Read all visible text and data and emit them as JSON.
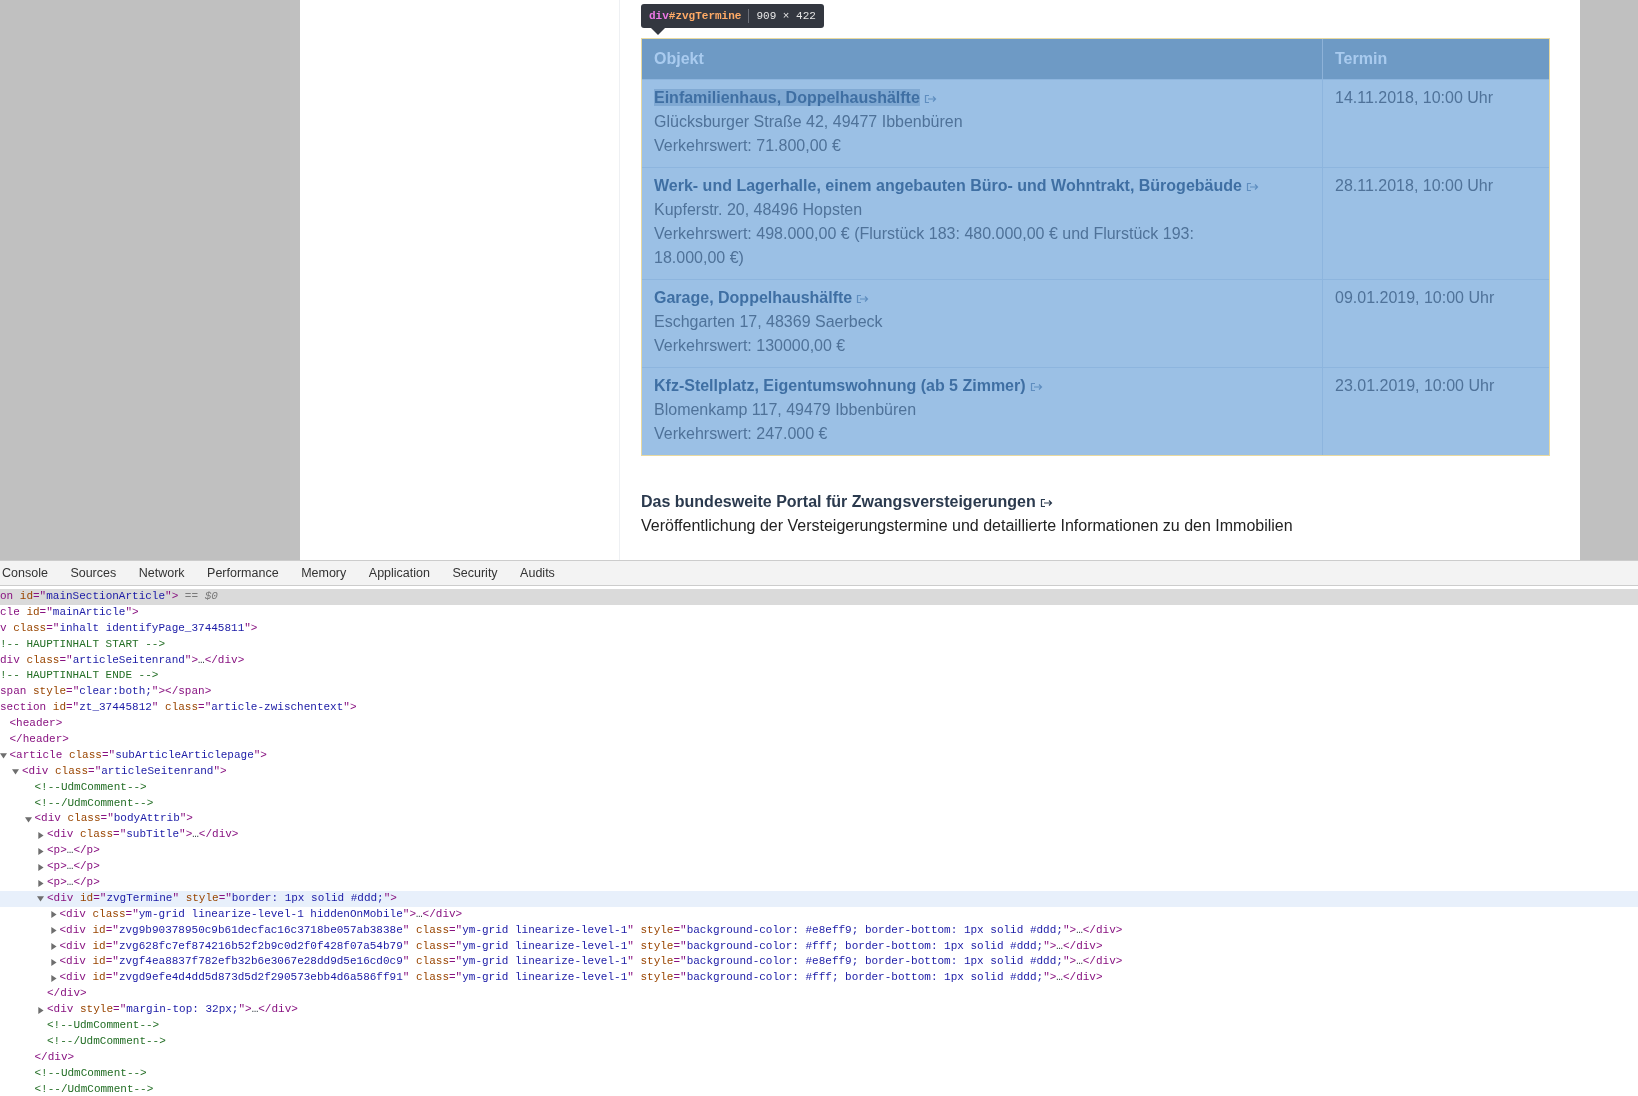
{
  "tooltip": {
    "tag": "div",
    "id": "#zvgTermine",
    "size": "909 × 422"
  },
  "table": {
    "columns": [
      "Objekt",
      "Termin"
    ],
    "rows": [
      {
        "title": "Einfamilienhaus, Doppelhaushälfte",
        "highlighted": true,
        "lines": [
          "Glücksburger Straße 42, 49477 Ibbenbüren",
          "Verkehrswert: 71.800,00 €"
        ],
        "date": "14.11.2018, 10:00 Uhr"
      },
      {
        "title": "Werk- und Lagerhalle, einem angebauten Büro- und Wohntrakt, Bürogebäude",
        "highlighted": false,
        "lines": [
          "Kupferstr. 20, 48496 Hopsten",
          "Verkehrswert: 498.000,00 € (Flurstück 183: 480.000,00 € und Flurstück 193: 18.000,00 €)"
        ],
        "date": "28.11.2018, 10:00 Uhr"
      },
      {
        "title": "Garage, Doppelhaushälfte",
        "highlighted": false,
        "lines": [
          "Eschgarten 17, 48369 Saerbeck",
          "Verkehrswert: 130000,00 €"
        ],
        "date": "09.01.2019, 10:00 Uhr"
      },
      {
        "title": "Kfz-Stellplatz, Eigentumswohnung (ab 5 Zimmer)",
        "highlighted": false,
        "lines": [
          "Blomenkamp 117, 49479 Ibbenbüren",
          "Verkehrswert: 247.000 €"
        ],
        "date": "23.01.2019, 10:00 Uhr"
      }
    ]
  },
  "portal": {
    "link": "Das bundesweite Portal für Zwangsversteigerungen",
    "description": "Veröffentlichung der Versteigerungstermine und detaillierte Informationen zu den Immobilien"
  },
  "devtools": {
    "tabs": [
      "Console",
      "Sources",
      "Network",
      "Performance",
      "Memory",
      "Application",
      "Security",
      "Audits"
    ],
    "nodes": [
      {
        "selected": true,
        "hovered": false,
        "tokens": [
          {
            "kind": "tag",
            "text": "on "
          },
          {
            "kind": "attr",
            "text": "id"
          },
          {
            "kind": "tag",
            "text": "=\""
          },
          {
            "kind": "value",
            "text": "mainSectionArticle"
          },
          {
            "kind": "tag",
            "text": "\">"
          },
          {
            "kind": "hint",
            "text": " == $0"
          }
        ]
      },
      {
        "selected": false,
        "hovered": false,
        "tokens": [
          {
            "kind": "tag",
            "text": "cle "
          },
          {
            "kind": "attr",
            "text": "id"
          },
          {
            "kind": "tag",
            "text": "=\""
          },
          {
            "kind": "value",
            "text": "mainArticle"
          },
          {
            "kind": "tag",
            "text": "\">"
          }
        ]
      },
      {
        "selected": false,
        "hovered": false,
        "tokens": [
          {
            "kind": "tag",
            "text": "v "
          },
          {
            "kind": "attr",
            "text": "class"
          },
          {
            "kind": "tag",
            "text": "=\""
          },
          {
            "kind": "value",
            "text": "inhalt identifyPage_37445811"
          },
          {
            "kind": "tag",
            "text": "\">"
          }
        ]
      },
      {
        "selected": false,
        "hovered": false,
        "tokens": [
          {
            "kind": "comment",
            "text": "!-- HAUPTINHALT START -->"
          }
        ]
      },
      {
        "selected": false,
        "hovered": false,
        "tokens": [
          {
            "kind": "tag",
            "text": "div "
          },
          {
            "kind": "attr",
            "text": "class"
          },
          {
            "kind": "tag",
            "text": "=\""
          },
          {
            "kind": "value",
            "text": "articleSeitenrand"
          },
          {
            "kind": "tag",
            "text": "\">"
          },
          {
            "kind": "plain",
            "text": "…"
          },
          {
            "kind": "tag",
            "text": "</div>"
          }
        ]
      },
      {
        "selected": false,
        "hovered": false,
        "tokens": [
          {
            "kind": "comment",
            "text": "!-- HAUPTINHALT ENDE -->"
          }
        ]
      },
      {
        "selected": false,
        "hovered": false,
        "tokens": [
          {
            "kind": "tag",
            "text": "span "
          },
          {
            "kind": "attr",
            "text": "style"
          },
          {
            "kind": "tag",
            "text": "=\""
          },
          {
            "kind": "value",
            "text": "clear:both;"
          },
          {
            "kind": "tag",
            "text": "\"></span>"
          }
        ]
      },
      {
        "selected": false,
        "hovered": false,
        "tokens": [
          {
            "kind": "tag",
            "text": "section "
          },
          {
            "kind": "attr",
            "text": "id"
          },
          {
            "kind": "tag",
            "text": "=\""
          },
          {
            "kind": "value",
            "text": "zt_37445812"
          },
          {
            "kind": "tag",
            "text": "\" "
          },
          {
            "kind": "attr",
            "text": "class"
          },
          {
            "kind": "tag",
            "text": "=\""
          },
          {
            "kind": "value",
            "text": "article-zwischentext"
          },
          {
            "kind": "tag",
            "text": "\">"
          }
        ],
        "children": [
          {
            "selected": false,
            "hovered": false,
            "tokens": [
              {
                "kind": "tag",
                "text": "<header>"
              }
            ]
          },
          {
            "selected": false,
            "hovered": false,
            "tokens": [
              {
                "kind": "tag",
                "text": "</header>"
              }
            ]
          },
          {
            "selected": false,
            "hovered": false,
            "expanded": true,
            "tokens": [
              {
                "kind": "tag",
                "text": "<article "
              },
              {
                "kind": "attr",
                "text": "class"
              },
              {
                "kind": "tag",
                "text": "=\""
              },
              {
                "kind": "value",
                "text": "subArticleArticlepage"
              },
              {
                "kind": "tag",
                "text": "\">"
              }
            ],
            "children": [
              {
                "selected": false,
                "hovered": false,
                "expanded": true,
                "tokens": [
                  {
                    "kind": "tag",
                    "text": "<div "
                  },
                  {
                    "kind": "attr",
                    "text": "class"
                  },
                  {
                    "kind": "tag",
                    "text": "=\""
                  },
                  {
                    "kind": "value",
                    "text": "articleSeitenrand"
                  },
                  {
                    "kind": "tag",
                    "text": "\">"
                  }
                ],
                "children": [
                  {
                    "selected": false,
                    "hovered": false,
                    "tokens": [
                      {
                        "kind": "comment",
                        "text": "<!--UdmComment-->"
                      }
                    ]
                  },
                  {
                    "selected": false,
                    "hovered": false,
                    "tokens": [
                      {
                        "kind": "comment",
                        "text": "<!--/UdmComment-->"
                      }
                    ]
                  },
                  {
                    "selected": false,
                    "hovered": false,
                    "expanded": true,
                    "tokens": [
                      {
                        "kind": "tag",
                        "text": "<div "
                      },
                      {
                        "kind": "attr",
                        "text": "class"
                      },
                      {
                        "kind": "tag",
                        "text": "=\""
                      },
                      {
                        "kind": "value",
                        "text": "bodyAttrib"
                      },
                      {
                        "kind": "tag",
                        "text": "\">"
                      }
                    ],
                    "closing": [
                      {
                        "kind": "tag",
                        "text": "</div>"
                      }
                    ],
                    "children": [
                      {
                        "selected": false,
                        "hovered": false,
                        "expanded": false,
                        "tokens": [
                          {
                            "kind": "tag",
                            "text": "<div "
                          },
                          {
                            "kind": "attr",
                            "text": "class"
                          },
                          {
                            "kind": "tag",
                            "text": "=\""
                          },
                          {
                            "kind": "value",
                            "text": "subTitle"
                          },
                          {
                            "kind": "tag",
                            "text": "\">"
                          },
                          {
                            "kind": "plain",
                            "text": "…"
                          },
                          {
                            "kind": "tag",
                            "text": "</div>"
                          }
                        ]
                      },
                      {
                        "selected": false,
                        "hovered": false,
                        "expanded": false,
                        "tokens": [
                          {
                            "kind": "tag",
                            "text": "<p>"
                          },
                          {
                            "kind": "plain",
                            "text": "…"
                          },
                          {
                            "kind": "tag",
                            "text": "</p>"
                          }
                        ]
                      },
                      {
                        "selected": false,
                        "hovered": false,
                        "expanded": false,
                        "tokens": [
                          {
                            "kind": "tag",
                            "text": "<p>"
                          },
                          {
                            "kind": "plain",
                            "text": "…"
                          },
                          {
                            "kind": "tag",
                            "text": "</p>"
                          }
                        ]
                      },
                      {
                        "selected": false,
                        "hovered": false,
                        "expanded": false,
                        "tokens": [
                          {
                            "kind": "tag",
                            "text": "<p>"
                          },
                          {
                            "kind": "plain",
                            "text": "…"
                          },
                          {
                            "kind": "tag",
                            "text": "</p>"
                          }
                        ]
                      },
                      {
                        "selected": false,
                        "hovered": true,
                        "expanded": true,
                        "tokens": [
                          {
                            "kind": "tag",
                            "text": "<div "
                          },
                          {
                            "kind": "attr",
                            "text": "id"
                          },
                          {
                            "kind": "tag",
                            "text": "=\""
                          },
                          {
                            "kind": "value",
                            "text": "zvgTermine"
                          },
                          {
                            "kind": "tag",
                            "text": "\" "
                          },
                          {
                            "kind": "attr",
                            "text": "style"
                          },
                          {
                            "kind": "tag",
                            "text": "=\""
                          },
                          {
                            "kind": "value",
                            "text": "border: 1px solid #ddd;"
                          },
                          {
                            "kind": "tag",
                            "text": "\">"
                          }
                        ],
                        "closing": [
                          {
                            "kind": "tag",
                            "text": "</div>"
                          }
                        ],
                        "children": [
                          {
                            "selected": false,
                            "hovered": false,
                            "expanded": false,
                            "tokens": [
                              {
                                "kind": "tag",
                                "text": "<div "
                              },
                              {
                                "kind": "attr",
                                "text": "class"
                              },
                              {
                                "kind": "tag",
                                "text": "=\""
                              },
                              {
                                "kind": "value",
                                "text": "ym-grid linearize-level-1 hiddenOnMobile"
                              },
                              {
                                "kind": "tag",
                                "text": "\">"
                              },
                              {
                                "kind": "plain",
                                "text": "…"
                              },
                              {
                                "kind": "tag",
                                "text": "</div>"
                              }
                            ]
                          },
                          {
                            "selected": false,
                            "hovered": false,
                            "expanded": false,
                            "tokens": [
                              {
                                "kind": "tag",
                                "text": "<div "
                              },
                              {
                                "kind": "attr",
                                "text": "id"
                              },
                              {
                                "kind": "tag",
                                "text": "=\""
                              },
                              {
                                "kind": "value",
                                "text": "zvg9b90378950c9b61decfac16c3718be057ab3838e"
                              },
                              {
                                "kind": "tag",
                                "text": "\" "
                              },
                              {
                                "kind": "attr",
                                "text": "class"
                              },
                              {
                                "kind": "tag",
                                "text": "=\""
                              },
                              {
                                "kind": "value",
                                "text": "ym-grid linearize-level-1"
                              },
                              {
                                "kind": "tag",
                                "text": "\" "
                              },
                              {
                                "kind": "attr",
                                "text": "style"
                              },
                              {
                                "kind": "tag",
                                "text": "=\""
                              },
                              {
                                "kind": "value",
                                "text": "background-color: #e8eff9; border-bottom: 1px solid #ddd;"
                              },
                              {
                                "kind": "tag",
                                "text": "\">"
                              },
                              {
                                "kind": "plain",
                                "text": "…"
                              },
                              {
                                "kind": "tag",
                                "text": "</div>"
                              }
                            ]
                          },
                          {
                            "selected": false,
                            "hovered": false,
                            "expanded": false,
                            "tokens": [
                              {
                                "kind": "tag",
                                "text": "<div "
                              },
                              {
                                "kind": "attr",
                                "text": "id"
                              },
                              {
                                "kind": "tag",
                                "text": "=\""
                              },
                              {
                                "kind": "value",
                                "text": "zvg628fc7ef874216b52f2b9c0d2f0f428f07a54b79"
                              },
                              {
                                "kind": "tag",
                                "text": "\" "
                              },
                              {
                                "kind": "attr",
                                "text": "class"
                              },
                              {
                                "kind": "tag",
                                "text": "=\""
                              },
                              {
                                "kind": "value",
                                "text": "ym-grid linearize-level-1"
                              },
                              {
                                "kind": "tag",
                                "text": "\" "
                              },
                              {
                                "kind": "attr",
                                "text": "style"
                              },
                              {
                                "kind": "tag",
                                "text": "=\""
                              },
                              {
                                "kind": "value",
                                "text": "background-color: #fff; border-bottom: 1px solid #ddd;"
                              },
                              {
                                "kind": "tag",
                                "text": "\">"
                              },
                              {
                                "kind": "plain",
                                "text": "…"
                              },
                              {
                                "kind": "tag",
                                "text": "</div>"
                              }
                            ]
                          },
                          {
                            "selected": false,
                            "hovered": false,
                            "expanded": false,
                            "tokens": [
                              {
                                "kind": "tag",
                                "text": "<div "
                              },
                              {
                                "kind": "attr",
                                "text": "id"
                              },
                              {
                                "kind": "tag",
                                "text": "=\""
                              },
                              {
                                "kind": "value",
                                "text": "zvgf4ea8837f782efb32b6e3067e28dd9d5e16cd0c9"
                              },
                              {
                                "kind": "tag",
                                "text": "\" "
                              },
                              {
                                "kind": "attr",
                                "text": "class"
                              },
                              {
                                "kind": "tag",
                                "text": "=\""
                              },
                              {
                                "kind": "value",
                                "text": "ym-grid linearize-level-1"
                              },
                              {
                                "kind": "tag",
                                "text": "\" "
                              },
                              {
                                "kind": "attr",
                                "text": "style"
                              },
                              {
                                "kind": "tag",
                                "text": "=\""
                              },
                              {
                                "kind": "value",
                                "text": "background-color: #e8eff9; border-bottom: 1px solid #ddd;"
                              },
                              {
                                "kind": "tag",
                                "text": "\">"
                              },
                              {
                                "kind": "plain",
                                "text": "…"
                              },
                              {
                                "kind": "tag",
                                "text": "</div>"
                              }
                            ]
                          },
                          {
                            "selected": false,
                            "hovered": false,
                            "expanded": false,
                            "tokens": [
                              {
                                "kind": "tag",
                                "text": "<div "
                              },
                              {
                                "kind": "attr",
                                "text": "id"
                              },
                              {
                                "kind": "tag",
                                "text": "=\""
                              },
                              {
                                "kind": "value",
                                "text": "zvgd9efe4d4dd5d873d5d2f290573ebb4d6a586ff91"
                              },
                              {
                                "kind": "tag",
                                "text": "\" "
                              },
                              {
                                "kind": "attr",
                                "text": "class"
                              },
                              {
                                "kind": "tag",
                                "text": "=\""
                              },
                              {
                                "kind": "value",
                                "text": "ym-grid linearize-level-1"
                              },
                              {
                                "kind": "tag",
                                "text": "\" "
                              },
                              {
                                "kind": "attr",
                                "text": "style"
                              },
                              {
                                "kind": "tag",
                                "text": "=\""
                              },
                              {
                                "kind": "value",
                                "text": "background-color: #fff; border-bottom: 1px solid #ddd;"
                              },
                              {
                                "kind": "tag",
                                "text": "\">"
                              },
                              {
                                "kind": "plain",
                                "text": "…"
                              },
                              {
                                "kind": "tag",
                                "text": "</div>"
                              }
                            ]
                          }
                        ]
                      },
                      {
                        "selected": false,
                        "hovered": false,
                        "expanded": false,
                        "tokens": [
                          {
                            "kind": "tag",
                            "text": "<div "
                          },
                          {
                            "kind": "attr",
                            "text": "style"
                          },
                          {
                            "kind": "tag",
                            "text": "=\""
                          },
                          {
                            "kind": "value",
                            "text": "margin-top: 32px;"
                          },
                          {
                            "kind": "tag",
                            "text": "\">"
                          },
                          {
                            "kind": "plain",
                            "text": "…"
                          },
                          {
                            "kind": "tag",
                            "text": "</div>"
                          }
                        ]
                      },
                      {
                        "selected": false,
                        "hovered": false,
                        "tokens": [
                          {
                            "kind": "comment",
                            "text": "<!--UdmComment-->"
                          }
                        ]
                      },
                      {
                        "selected": false,
                        "hovered": false,
                        "tokens": [
                          {
                            "kind": "comment",
                            "text": "<!--/UdmComment-->"
                          }
                        ]
                      }
                    ]
                  },
                  {
                    "selected": false,
                    "hovered": false,
                    "tokens": [
                      {
                        "kind": "comment",
                        "text": "<!--UdmComment-->"
                      }
                    ]
                  },
                  {
                    "selected": false,
                    "hovered": false,
                    "tokens": [
                      {
                        "kind": "comment",
                        "text": "<!--/UdmComment-->"
                      }
                    ]
                  }
                ]
              }
            ]
          }
        ]
      }
    ]
  }
}
